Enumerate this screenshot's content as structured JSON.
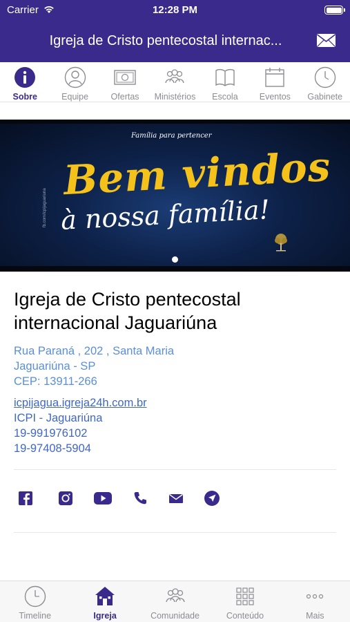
{
  "status_bar": {
    "carrier": "Carrier",
    "time": "12:28 PM"
  },
  "header": {
    "title": "Igreja de Cristo pentecostal internac...",
    "mail_icon": "mail-icon"
  },
  "tabs": [
    {
      "label": "Sobre",
      "icon": "info-icon",
      "active": true
    },
    {
      "label": "Equipe",
      "icon": "person-icon",
      "active": false
    },
    {
      "label": "Ofertas",
      "icon": "money-icon",
      "active": false
    },
    {
      "label": "Ministérios",
      "icon": "group-icon",
      "active": false
    },
    {
      "label": "Escola",
      "icon": "book-icon",
      "active": false
    },
    {
      "label": "Eventos",
      "icon": "calendar-icon",
      "active": false
    },
    {
      "label": "Gabinete",
      "icon": "clock-icon",
      "active": false
    }
  ],
  "banner": {
    "tagline": "Família para pertencer",
    "headline": "Bem vindos",
    "subline": "à nossa família!",
    "side_text": "fb.com/icpijaguariuna"
  },
  "church": {
    "name_line1": "Igreja de Cristo pentecostal",
    "name_line2": "internacional Jaguariúna",
    "address": {
      "street": "Rua Paraná , 202 , Santa Maria",
      "city": "Jaguariúna - SP",
      "cep": "CEP: 13911-266"
    },
    "contact": {
      "website": "icpijagua.igreja24h.com.br",
      "short_name": "ICPI - Jaguariúna",
      "phone1": "19-991976102",
      "phone2": "19-97408-5904"
    }
  },
  "social": [
    "facebook-icon",
    "instagram-icon",
    "youtube-icon",
    "phone-icon",
    "email-icon",
    "location-icon"
  ],
  "bottom_tabs": [
    {
      "label": "Timeline",
      "icon": "clock-icon",
      "active": false
    },
    {
      "label": "Igreja",
      "icon": "church-icon",
      "active": true
    },
    {
      "label": "Comunidade",
      "icon": "group-icon",
      "active": false
    },
    {
      "label": "Conteúdo",
      "icon": "grid-icon",
      "active": false
    },
    {
      "label": "Mais",
      "icon": "more-icon",
      "active": false
    }
  ],
  "colors": {
    "primary": "#3a2a8c",
    "link": "#3f67c4",
    "address": "#5a8fd6",
    "inactive": "#8c8c93",
    "banner_gold": "#f4c21b"
  }
}
